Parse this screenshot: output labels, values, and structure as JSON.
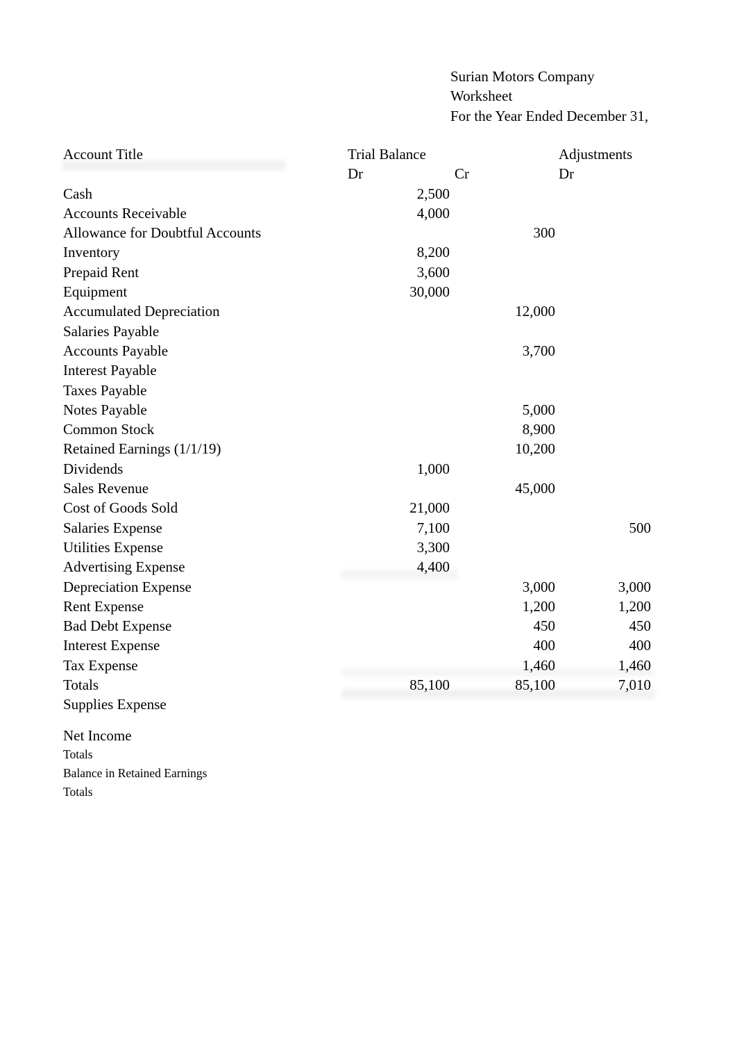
{
  "document": {
    "company": "Surian Motors Company",
    "doc_type": "Worksheet",
    "period": "For the Year Ended December 31,"
  },
  "headers": {
    "account_title": "Account Title",
    "trial_balance": "Trial Balance",
    "adjustments": "Adjustments",
    "tb_dr": "Dr",
    "tb_cr": "Cr",
    "adj_dr": "Dr"
  },
  "rows": [
    {
      "title": "Cash",
      "tb_dr": "2,500",
      "tb_cr": "",
      "adj_dr": ""
    },
    {
      "title": "Accounts Receivable",
      "tb_dr": "4,000",
      "tb_cr": "",
      "adj_dr": ""
    },
    {
      "title": "Allowance for Doubtful Accounts",
      "tb_dr": "",
      "tb_cr": "300",
      "adj_dr": ""
    },
    {
      "title": "Inventory",
      "tb_dr": "8,200",
      "tb_cr": "",
      "adj_dr": ""
    },
    {
      "title": "Prepaid Rent",
      "tb_dr": "3,600",
      "tb_cr": "",
      "adj_dr": ""
    },
    {
      "title": "Equipment",
      "tb_dr": "30,000",
      "tb_cr": "",
      "adj_dr": ""
    },
    {
      "title": "Accumulated Depreciation",
      "tb_dr": "",
      "tb_cr": "12,000",
      "adj_dr": ""
    },
    {
      "title": "Salaries Payable",
      "tb_dr": "",
      "tb_cr": "",
      "adj_dr": ""
    },
    {
      "title": "Accounts Payable",
      "tb_dr": "",
      "tb_cr": "3,700",
      "adj_dr": ""
    },
    {
      "title": "Interest Payable",
      "tb_dr": "",
      "tb_cr": "",
      "adj_dr": ""
    },
    {
      "title": "Taxes Payable",
      "tb_dr": "",
      "tb_cr": "",
      "adj_dr": ""
    },
    {
      "title": "Notes Payable",
      "tb_dr": "",
      "tb_cr": "5,000",
      "adj_dr": ""
    },
    {
      "title": "Common Stock",
      "tb_dr": "",
      "tb_cr": "8,900",
      "adj_dr": ""
    },
    {
      "title": "Retained Earnings (1/1/19)",
      "tb_dr": "",
      "tb_cr": "10,200",
      "adj_dr": ""
    },
    {
      "title": "Dividends",
      "tb_dr": "1,000",
      "tb_cr": "",
      "adj_dr": ""
    },
    {
      "title": "Sales Revenue",
      "tb_dr": "",
      "tb_cr": "45,000",
      "adj_dr": ""
    },
    {
      "title": "Cost of Goods Sold",
      "tb_dr": "21,000",
      "tb_cr": "",
      "adj_dr": ""
    },
    {
      "title": "Salaries Expense",
      "tb_dr": "7,100",
      "tb_cr": "",
      "adj_dr": "500"
    },
    {
      "title": "Utilities Expense",
      "tb_dr": "3,300",
      "tb_cr": "",
      "adj_dr": ""
    },
    {
      "title": "Advertising Expense",
      "tb_dr": "4,400",
      "tb_cr": "",
      "adj_dr": ""
    },
    {
      "title": "Depreciation Expense",
      "tb_dr": "",
      "tb_cr": "3,000",
      "adj_dr": "3,000"
    },
    {
      "title": "Rent Expense",
      "tb_dr": "",
      "tb_cr": "1,200",
      "adj_dr": "1,200"
    },
    {
      "title": "Bad Debt Expense",
      "tb_dr": "",
      "tb_cr": "450",
      "adj_dr": "450"
    },
    {
      "title": "Interest Expense",
      "tb_dr": "",
      "tb_cr": "400",
      "adj_dr": "400"
    },
    {
      "title": "Tax Expense",
      "tb_dr": "",
      "tb_cr": "1,460",
      "adj_dr": "1,460"
    },
    {
      "title": "Totals",
      "tb_dr": "85,100",
      "tb_cr": "85,100",
      "adj_dr": "7,010"
    },
    {
      "title": "Supplies Expense",
      "tb_dr": "",
      "tb_cr": "",
      "adj_dr": ""
    }
  ],
  "summary_rows": [
    {
      "title": "Net Income",
      "size": "large",
      "tb_dr": "",
      "tb_cr": "",
      "adj_dr": ""
    },
    {
      "title": "Totals",
      "size": "small",
      "tb_dr": "",
      "tb_cr": "",
      "adj_dr": ""
    },
    {
      "title": "Balance in Retained Earnings",
      "size": "small",
      "tb_dr": "",
      "tb_cr": "",
      "adj_dr": ""
    },
    {
      "title": "Totals",
      "size": "small",
      "tb_dr": "",
      "tb_cr": "",
      "adj_dr": ""
    }
  ]
}
